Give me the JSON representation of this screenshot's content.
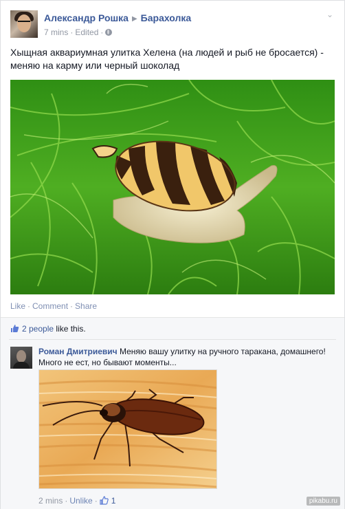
{
  "post": {
    "author": "Александр Рошка",
    "group": "Барахолка",
    "time": "7 mins",
    "edited": "Edited",
    "text": "Хыщная аквариумная улитка Хелена (на людей и рыб не бросается) - меняю на карму или черный шоколад",
    "actions": {
      "like": "Like",
      "comment": "Comment",
      "share": "Share"
    }
  },
  "likes": {
    "count_text": "2 people",
    "suffix": " like this."
  },
  "comment": {
    "author": "Роман Дмитриевич",
    "text": "Меняю вашу улитку на ручного таракана, домашнего! Много не ест, но бывают моменты...",
    "time": "2 mins",
    "unlike": "Unlike",
    "like_count": "1"
  },
  "watermark": "pikabu.ru",
  "colors": {
    "link": "#3b5998",
    "meta": "#9197a3",
    "feedback_bg": "#f6f7f9"
  },
  "icons": {
    "header_menu": "chevron-down-icon",
    "privacy": "globe-icon",
    "likes": "thumbs-up-icon"
  }
}
